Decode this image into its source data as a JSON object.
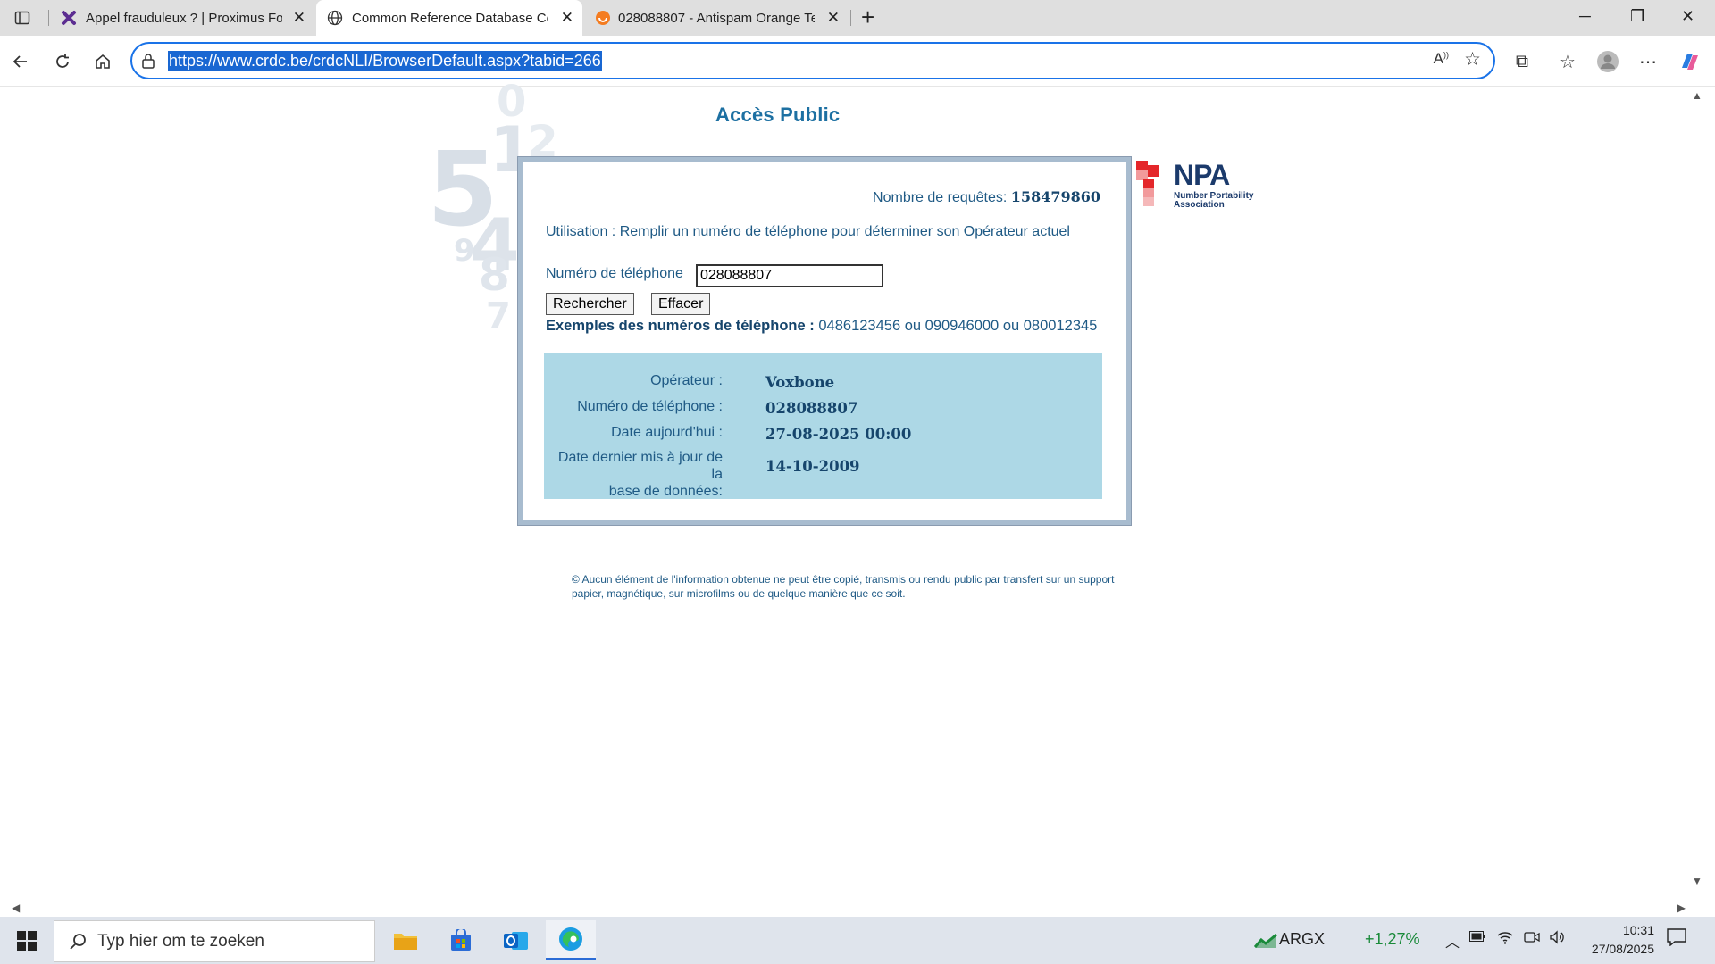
{
  "browser": {
    "tabs": [
      {
        "title": "Appel frauduleux ? | Proximus For",
        "active": false
      },
      {
        "title": "Common Reference Database Cer",
        "active": true
      },
      {
        "title": "028088807 - Antispam Orange Te",
        "active": false
      }
    ],
    "url": "https://www.crdc.be/crdcNLI/BrowserDefault.aspx?tabid=266"
  },
  "page": {
    "title": "Accès Public",
    "request_count_label": "Nombre de requêtes:",
    "request_count_value": "158479860",
    "usage_text": "Utilisation : Remplir un numéro de téléphone pour déterminer son Opérateur actuel",
    "phone_label": "Numéro de téléphone",
    "phone_value": "028088807",
    "search_button": "Rechercher",
    "clear_button": "Effacer",
    "examples_label": "Exemples des numéros de téléphone :",
    "examples_values": "0486123456 ou 090946000 ou 080012345",
    "result": {
      "operator_label": "Opérateur :",
      "operator_value": "Voxbone",
      "number_label": "Numéro de téléphone :",
      "number_value": "028088807",
      "date_label": "Date aujourd'hui :",
      "date_value": "27-08-2025 00:00",
      "update_label_line1": "Date dernier mis à jour de la",
      "update_label_line2": "base de données:",
      "update_value": "14-10-2009"
    },
    "footer": "© Aucun élément de l'information obtenue ne peut être copié, transmis ou rendu public par transfert sur un support papier, magnétique, sur microfilms ou de quelque manière que ce soit.",
    "logo": {
      "name": "NPA",
      "line1": "Number Portability",
      "line2": "Association"
    },
    "deco_digits": [
      "1",
      "0",
      "2",
      "5",
      "4",
      "9",
      "8",
      "7"
    ]
  },
  "taskbar": {
    "search_placeholder": "Typ hier om te zoeken",
    "stock_symbol": "ARGX",
    "stock_change": "+1,27%",
    "time": "10:31",
    "date": "27/08/2025"
  },
  "colors": {
    "brand_blue": "#1d70a2",
    "result_bg": "#add8e6",
    "npa_red": "#e4262a"
  }
}
